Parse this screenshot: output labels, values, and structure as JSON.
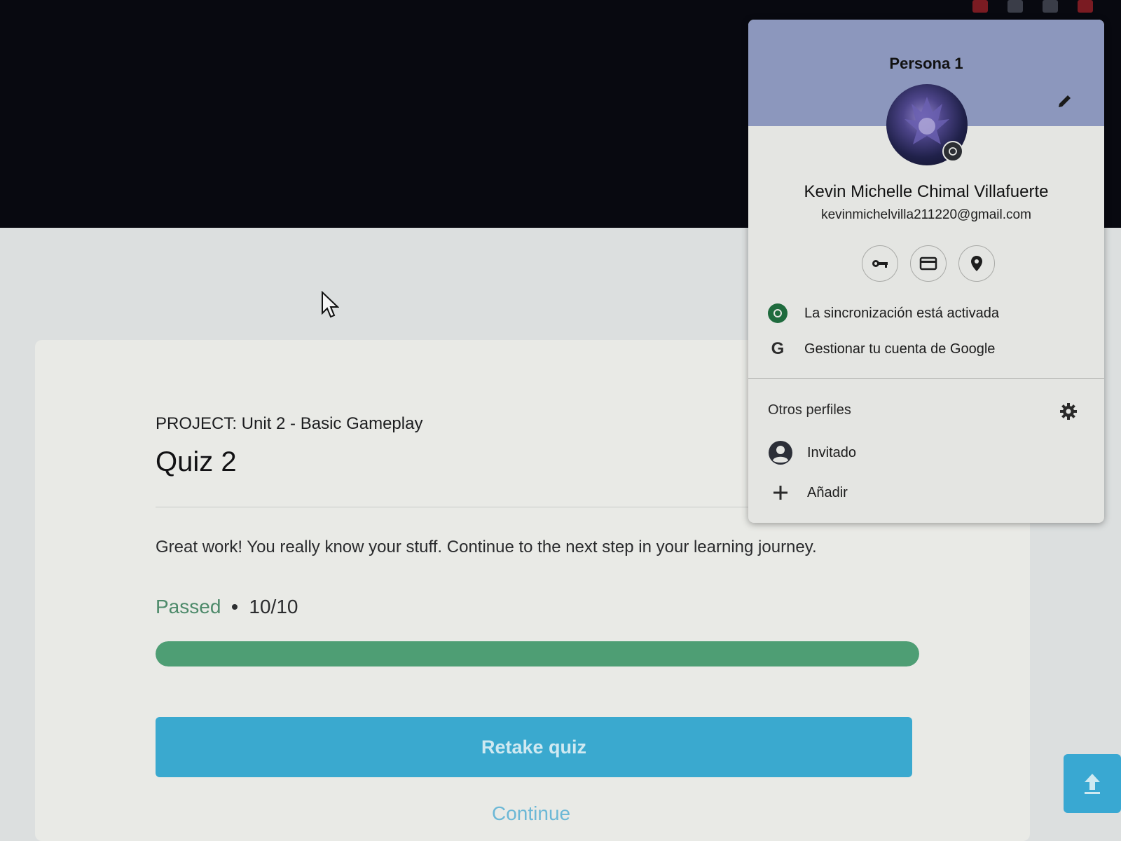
{
  "browser": {
    "toolbar_icons": [
      "extension-icon",
      "puzzle-icon",
      "sidebar-icon",
      "profile-icon"
    ]
  },
  "quiz_page": {
    "project_label": "PROJECT:  Unit 2 - Basic Gameplay",
    "title": "Quiz 2",
    "result_message": "Great work! You really know your stuff. Continue to the next step in your learning journey.",
    "status": "Passed",
    "score": "10/10",
    "progress_fraction": 1.0,
    "retake_label": "Retake quiz",
    "continue_label": "Continue",
    "colors": {
      "progress": "#4e9e74",
      "button": "#3aa9cf"
    }
  },
  "profile_popup": {
    "persona_name": "Persona 1",
    "full_name": "Kevin Michelle Chimal Villafuerte",
    "email": "kevinmichelvilla211220@gmail.com",
    "quick_actions": [
      "key-icon",
      "card-icon",
      "location-pin-icon"
    ],
    "sync_status": "La sincronización está activada",
    "manage_account": "Gestionar tu cuenta de Google",
    "google_mark": "G",
    "other_profiles_label": "Otros perfiles",
    "guest_label": "Invitado",
    "add_label": "Añadir",
    "colors": {
      "header": "#8c97bd",
      "sync": "#1f6b3e"
    }
  }
}
